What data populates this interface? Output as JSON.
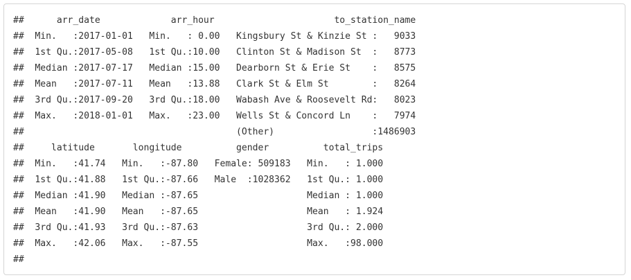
{
  "console_output": {
    "lines": [
      "##      arr_date             arr_hour                      to_station_name  ",
      "##  Min.   :2017-01-01   Min.   : 0.00   Kingsbury St & Kinzie St :   9033  ",
      "##  1st Qu.:2017-05-08   1st Qu.:10.00   Clinton St & Madison St  :   8773  ",
      "##  Median :2017-07-17   Median :15.00   Dearborn St & Erie St    :   8575  ",
      "##  Mean   :2017-07-11   Mean   :13.88   Clark St & Elm St        :   8264  ",
      "##  3rd Qu.:2017-09-20   3rd Qu.:18.00   Wabash Ave & Roosevelt Rd:   8023  ",
      "##  Max.   :2018-01-01   Max.   :23.00   Wells St & Concord Ln    :   7974  ",
      "##                                       (Other)                  :1486903  ",
      "##     latitude       longitude          gender          total_trips    ",
      "##  Min.   :41.74   Min.   :-87.80   Female: 509183   Min.   : 1.000  ",
      "##  1st Qu.:41.88   1st Qu.:-87.66   Male  :1028362   1st Qu.: 1.000  ",
      "##  Median :41.90   Median :-87.65                    Median : 1.000  ",
      "##  Mean   :41.90   Mean   :-87.65                    Mean   : 1.924  ",
      "##  3rd Qu.:41.93   3rd Qu.:-87.63                    3rd Qu.: 2.000  ",
      "##  Max.   :42.06   Max.   :-87.55                    Max.   :98.000  ",
      "##"
    ]
  }
}
